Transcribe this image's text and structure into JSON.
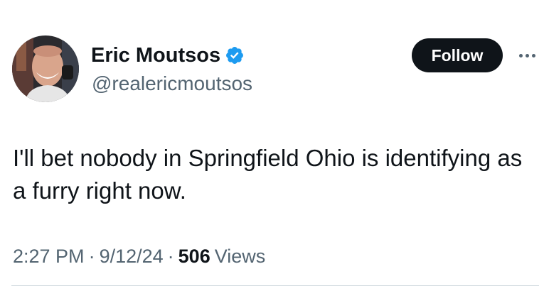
{
  "author": {
    "display_name": "Eric Moutsos",
    "handle": "@realericmoutsos",
    "verified": true,
    "avatar_icon": "profile-photo"
  },
  "actions": {
    "follow_label": "Follow",
    "more_icon": "more-horizontal-icon"
  },
  "tweet": {
    "text": "I'll bet nobody in Springfield Ohio is identifying as a furry right now."
  },
  "meta": {
    "time": "2:27 PM",
    "separator": "·",
    "date": "9/12/24",
    "views_count": "506",
    "views_label": "Views"
  },
  "colors": {
    "text_primary": "#0f1419",
    "text_secondary": "#536471",
    "verified_blue": "#1d9bf0",
    "follow_bg": "#0f1419"
  }
}
